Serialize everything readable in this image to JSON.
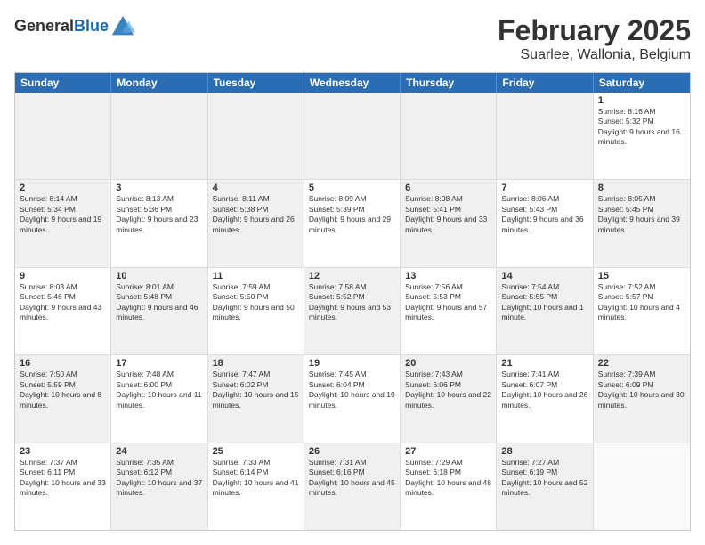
{
  "header": {
    "logo_line1": "General",
    "logo_line2": "Blue",
    "main_title": "February 2025",
    "subtitle": "Suarlee, Wallonia, Belgium"
  },
  "weekdays": [
    "Sunday",
    "Monday",
    "Tuesday",
    "Wednesday",
    "Thursday",
    "Friday",
    "Saturday"
  ],
  "rows": [
    [
      {
        "day": "",
        "detail": "",
        "shaded": true
      },
      {
        "day": "",
        "detail": "",
        "shaded": true
      },
      {
        "day": "",
        "detail": "",
        "shaded": true
      },
      {
        "day": "",
        "detail": "",
        "shaded": true
      },
      {
        "day": "",
        "detail": "",
        "shaded": true
      },
      {
        "day": "",
        "detail": "",
        "shaded": true
      },
      {
        "day": "1",
        "detail": "Sunrise: 8:16 AM\nSunset: 5:32 PM\nDaylight: 9 hours and 16 minutes.",
        "shaded": false
      }
    ],
    [
      {
        "day": "2",
        "detail": "Sunrise: 8:14 AM\nSunset: 5:34 PM\nDaylight: 9 hours and 19 minutes.",
        "shaded": true
      },
      {
        "day": "3",
        "detail": "Sunrise: 8:13 AM\nSunset: 5:36 PM\nDaylight: 9 hours and 23 minutes.",
        "shaded": false
      },
      {
        "day": "4",
        "detail": "Sunrise: 8:11 AM\nSunset: 5:38 PM\nDaylight: 9 hours and 26 minutes.",
        "shaded": true
      },
      {
        "day": "5",
        "detail": "Sunrise: 8:09 AM\nSunset: 5:39 PM\nDaylight: 9 hours and 29 minutes.",
        "shaded": false
      },
      {
        "day": "6",
        "detail": "Sunrise: 8:08 AM\nSunset: 5:41 PM\nDaylight: 9 hours and 33 minutes.",
        "shaded": true
      },
      {
        "day": "7",
        "detail": "Sunrise: 8:06 AM\nSunset: 5:43 PM\nDaylight: 9 hours and 36 minutes.",
        "shaded": false
      },
      {
        "day": "8",
        "detail": "Sunrise: 8:05 AM\nSunset: 5:45 PM\nDaylight: 9 hours and 39 minutes.",
        "shaded": true
      }
    ],
    [
      {
        "day": "9",
        "detail": "Sunrise: 8:03 AM\nSunset: 5:46 PM\nDaylight: 9 hours and 43 minutes.",
        "shaded": false
      },
      {
        "day": "10",
        "detail": "Sunrise: 8:01 AM\nSunset: 5:48 PM\nDaylight: 9 hours and 46 minutes.",
        "shaded": true
      },
      {
        "day": "11",
        "detail": "Sunrise: 7:59 AM\nSunset: 5:50 PM\nDaylight: 9 hours and 50 minutes.",
        "shaded": false
      },
      {
        "day": "12",
        "detail": "Sunrise: 7:58 AM\nSunset: 5:52 PM\nDaylight: 9 hours and 53 minutes.",
        "shaded": true
      },
      {
        "day": "13",
        "detail": "Sunrise: 7:56 AM\nSunset: 5:53 PM\nDaylight: 9 hours and 57 minutes.",
        "shaded": false
      },
      {
        "day": "14",
        "detail": "Sunrise: 7:54 AM\nSunset: 5:55 PM\nDaylight: 10 hours and 1 minute.",
        "shaded": true
      },
      {
        "day": "15",
        "detail": "Sunrise: 7:52 AM\nSunset: 5:57 PM\nDaylight: 10 hours and 4 minutes.",
        "shaded": false
      }
    ],
    [
      {
        "day": "16",
        "detail": "Sunrise: 7:50 AM\nSunset: 5:59 PM\nDaylight: 10 hours and 8 minutes.",
        "shaded": true
      },
      {
        "day": "17",
        "detail": "Sunrise: 7:48 AM\nSunset: 6:00 PM\nDaylight: 10 hours and 11 minutes.",
        "shaded": false
      },
      {
        "day": "18",
        "detail": "Sunrise: 7:47 AM\nSunset: 6:02 PM\nDaylight: 10 hours and 15 minutes.",
        "shaded": true
      },
      {
        "day": "19",
        "detail": "Sunrise: 7:45 AM\nSunset: 6:04 PM\nDaylight: 10 hours and 19 minutes.",
        "shaded": false
      },
      {
        "day": "20",
        "detail": "Sunrise: 7:43 AM\nSunset: 6:06 PM\nDaylight: 10 hours and 22 minutes.",
        "shaded": true
      },
      {
        "day": "21",
        "detail": "Sunrise: 7:41 AM\nSunset: 6:07 PM\nDaylight: 10 hours and 26 minutes.",
        "shaded": false
      },
      {
        "day": "22",
        "detail": "Sunrise: 7:39 AM\nSunset: 6:09 PM\nDaylight: 10 hours and 30 minutes.",
        "shaded": true
      }
    ],
    [
      {
        "day": "23",
        "detail": "Sunrise: 7:37 AM\nSunset: 6:11 PM\nDaylight: 10 hours and 33 minutes.",
        "shaded": false
      },
      {
        "day": "24",
        "detail": "Sunrise: 7:35 AM\nSunset: 6:12 PM\nDaylight: 10 hours and 37 minutes.",
        "shaded": true
      },
      {
        "day": "25",
        "detail": "Sunrise: 7:33 AM\nSunset: 6:14 PM\nDaylight: 10 hours and 41 minutes.",
        "shaded": false
      },
      {
        "day": "26",
        "detail": "Sunrise: 7:31 AM\nSunset: 6:16 PM\nDaylight: 10 hours and 45 minutes.",
        "shaded": true
      },
      {
        "day": "27",
        "detail": "Sunrise: 7:29 AM\nSunset: 6:18 PM\nDaylight: 10 hours and 48 minutes.",
        "shaded": false
      },
      {
        "day": "28",
        "detail": "Sunrise: 7:27 AM\nSunset: 6:19 PM\nDaylight: 10 hours and 52 minutes.",
        "shaded": true
      },
      {
        "day": "",
        "detail": "",
        "shaded": false
      }
    ]
  ]
}
